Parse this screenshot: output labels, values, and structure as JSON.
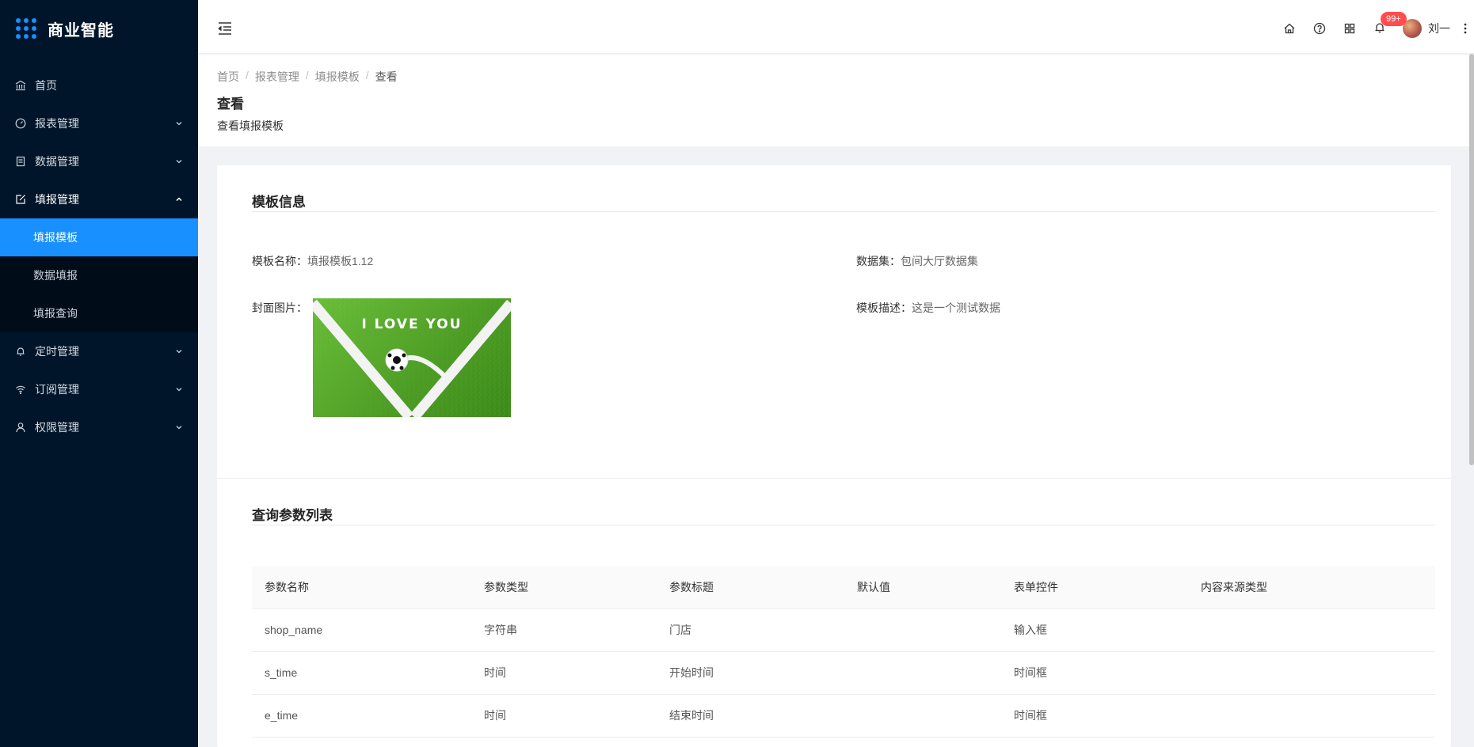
{
  "app": {
    "title": "商业智能"
  },
  "sidebar": {
    "items": [
      {
        "label": "首页",
        "icon": "bank-icon"
      },
      {
        "label": "报表管理",
        "icon": "dashboard-icon"
      },
      {
        "label": "数据管理",
        "icon": "table-icon"
      },
      {
        "label": "填报管理",
        "icon": "edit-icon",
        "open": true
      },
      {
        "label": "定时管理",
        "icon": "bell-icon"
      },
      {
        "label": "订阅管理",
        "icon": "wifi-icon"
      },
      {
        "label": "权限管理",
        "icon": "user-icon"
      }
    ],
    "sub_items": [
      {
        "label": "填报模板",
        "active": true
      },
      {
        "label": "数据填报"
      },
      {
        "label": "填报查询"
      }
    ]
  },
  "header": {
    "badge": "99+",
    "username": "刘一"
  },
  "breadcrumb": [
    "首页",
    "报表管理",
    "填报模板",
    "查看"
  ],
  "page": {
    "title": "查看",
    "subtitle": "查看填报模板"
  },
  "template_info": {
    "section_title": "模板信息",
    "name_label": "模板名称：",
    "name_value": "填报模板1.12",
    "dataset_label": "数据集：",
    "dataset_value": "包间大厅数据集",
    "cover_label": "封面图片：",
    "cover_text": "I LOVE YOU",
    "desc_label": "模板描述：",
    "desc_value": "这是一个测试数据"
  },
  "params": {
    "section_title": "查询参数列表",
    "columns": [
      "参数名称",
      "参数类型",
      "参数标题",
      "默认值",
      "表单控件",
      "内容来源类型"
    ],
    "rows": [
      [
        "shop_name",
        "字符串",
        "门店",
        "",
        "输入框",
        ""
      ],
      [
        "s_time",
        "时间",
        "开始时间",
        "",
        "时间框",
        ""
      ],
      [
        "e_time",
        "时间",
        "结束时间",
        "",
        "时间框",
        ""
      ]
    ]
  },
  "colors": {
    "sidebar_bg": "#001529",
    "accent": "#1890ff",
    "badge": "#ff4d4f"
  }
}
